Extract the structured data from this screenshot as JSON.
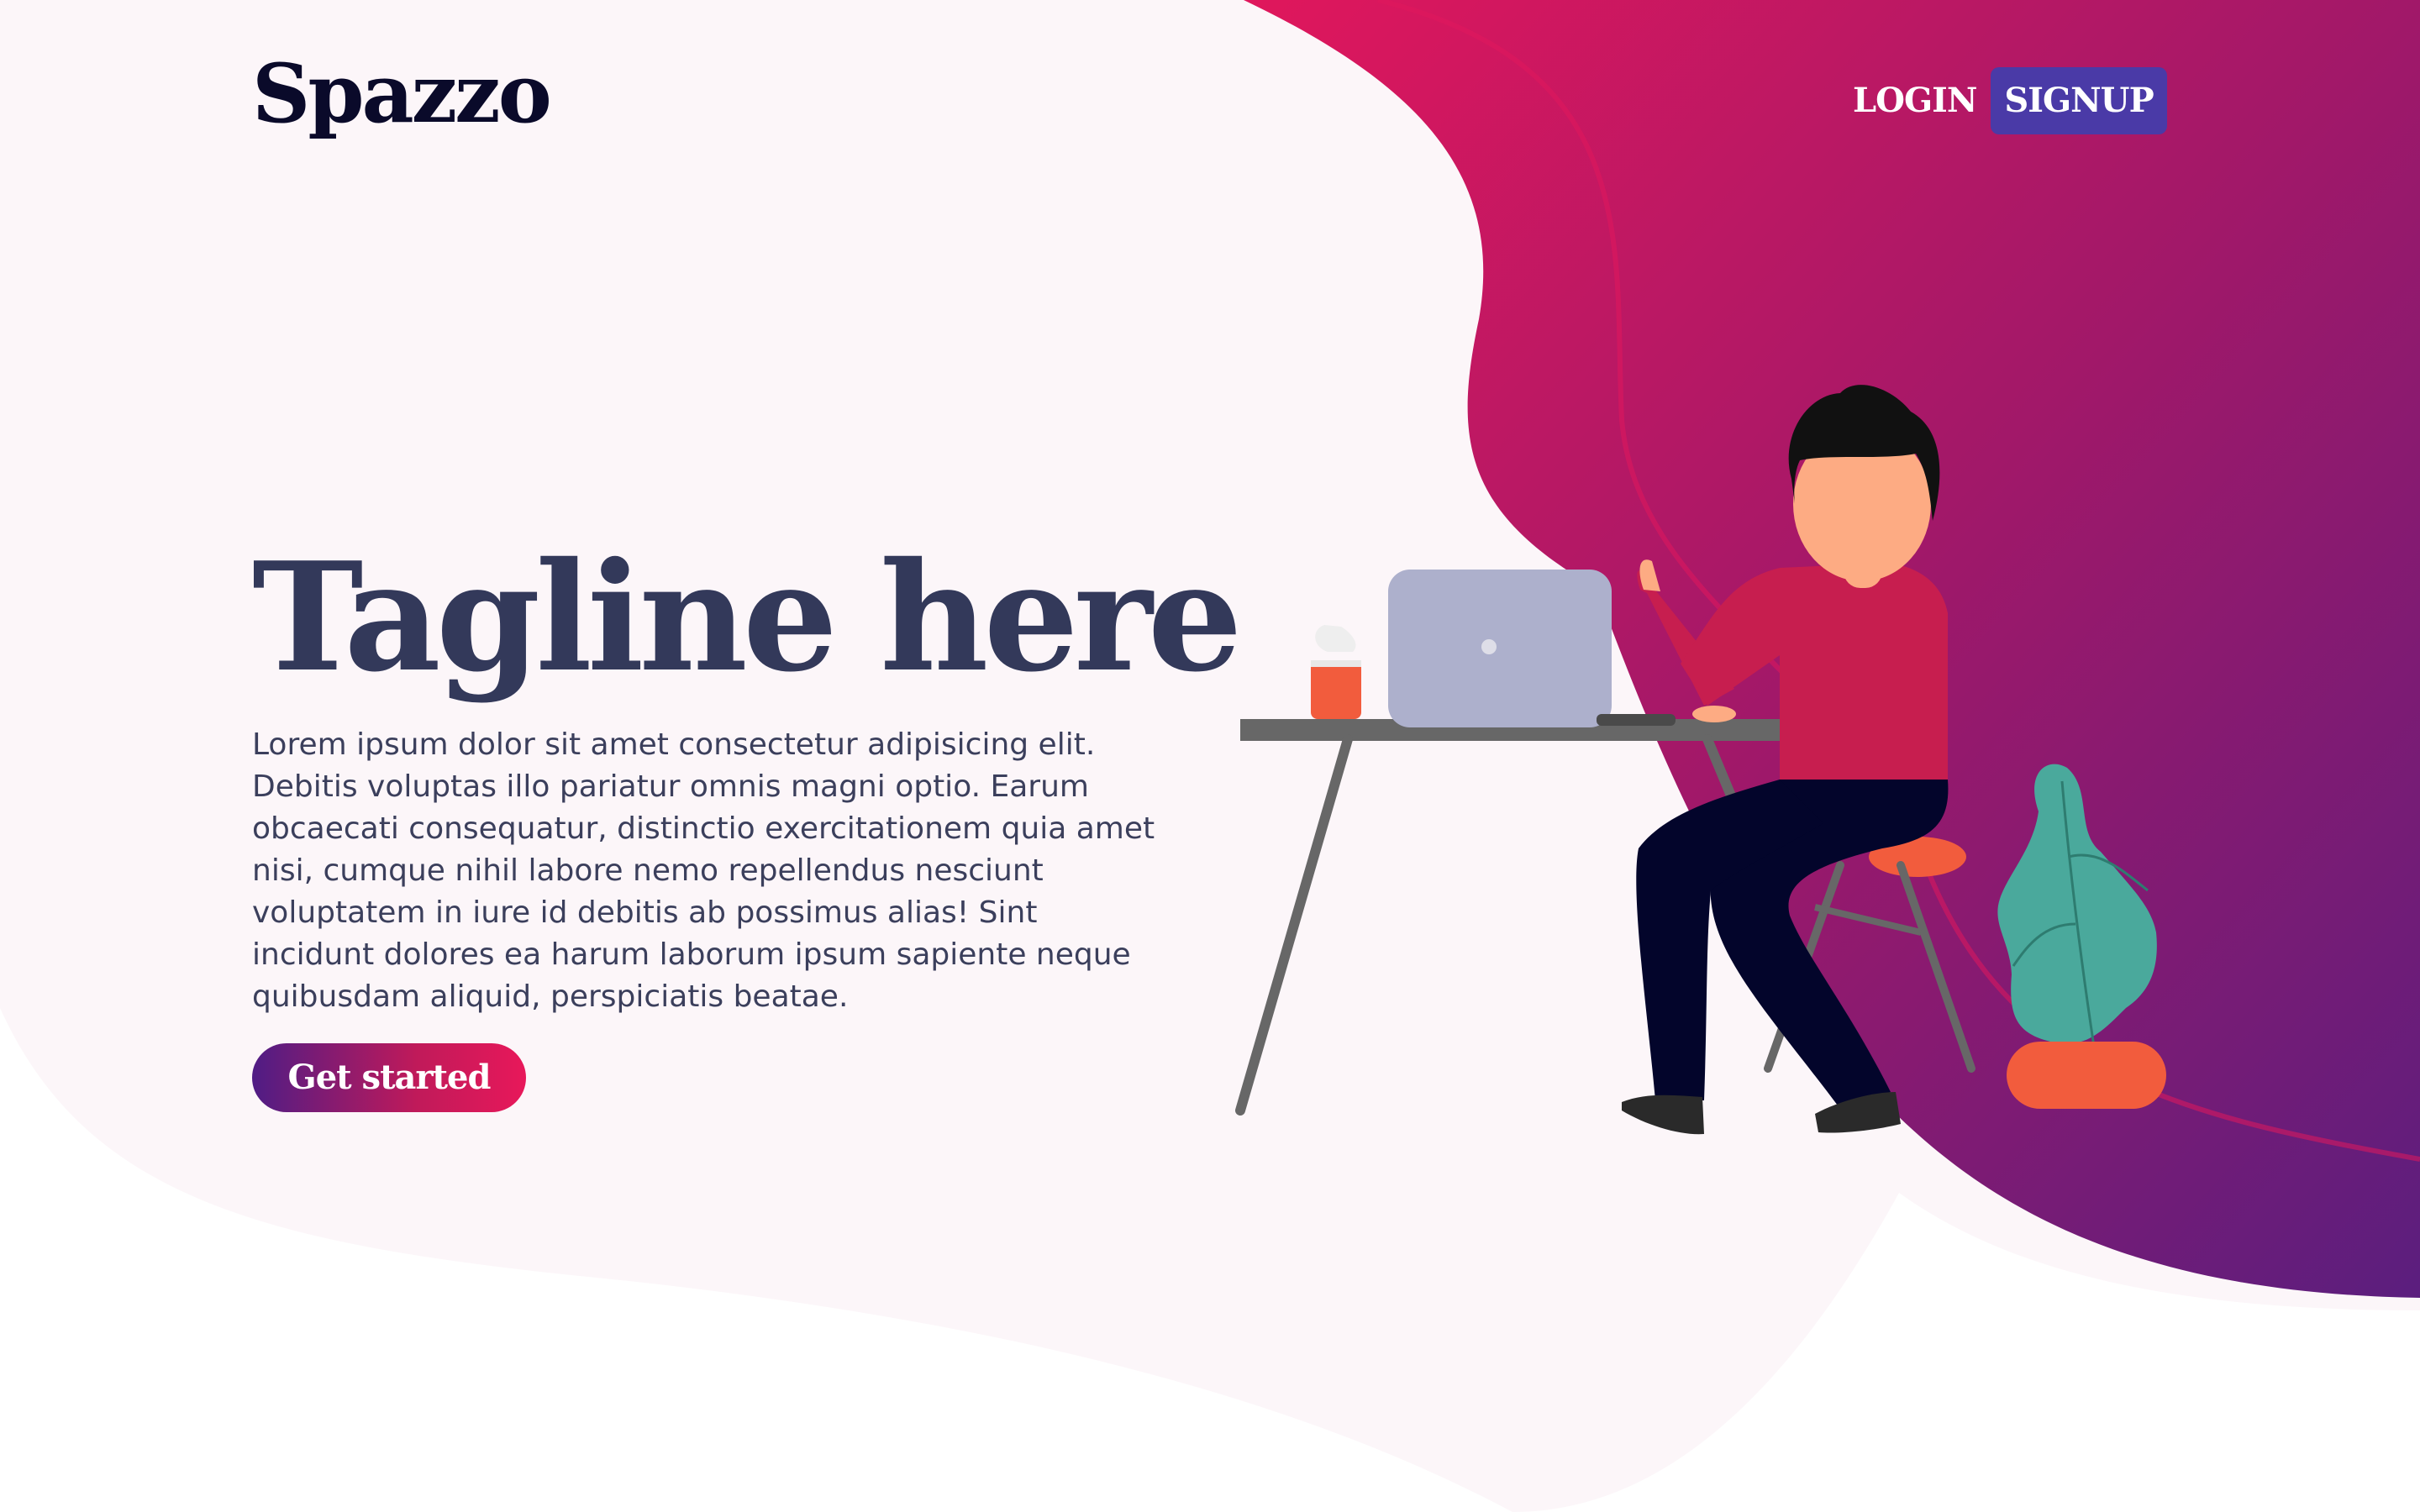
{
  "brand": {
    "name": "Spazzo"
  },
  "nav": {
    "login_label": "LOGIN",
    "signup_label": "SIGNUP"
  },
  "hero": {
    "tagline": "Tagline here",
    "description": "Lorem ipsum dolor sit amet consectetur adipisicing elit. Debitis voluptas illo pariatur omnis magni optio. Earum obcaecati consequatur, distinctio exercitationem quia amet nisi, cumque nihil labore nemo repellendus nesciunt voluptatem in iure id debitis ab possimus alias! Sint incidunt dolores ea harum laborum ipsum sapiente neque quibusdam aliquid, perspiciatis beatae.",
    "cta_label": "Get started"
  },
  "colors": {
    "background_tint": "#fcf6f9",
    "gradient_start": "#e0175c",
    "gradient_end": "#5b1e7e",
    "signup_button": "#4a3aa7",
    "heading": "#33395a",
    "logo": "#0a0a2a"
  },
  "illustration": {
    "name": "person-working-at-desk"
  }
}
